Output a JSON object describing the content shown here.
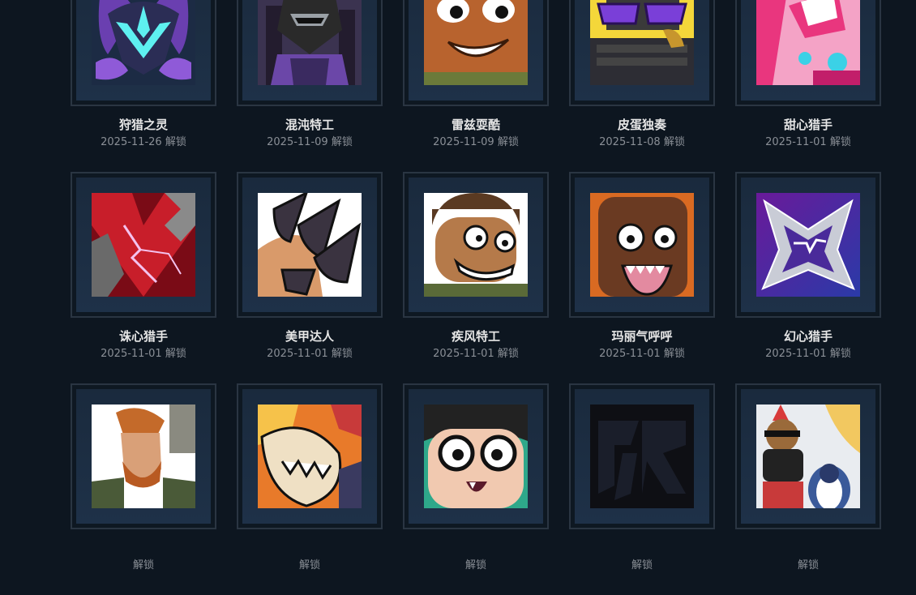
{
  "unlock_suffix": "解锁",
  "cards": [
    {
      "name": "狩猎之灵",
      "date": "2025-11-26",
      "icon": "hunting-spirit-mask-icon"
    },
    {
      "name": "混沌特工",
      "date": "2025-11-09",
      "icon": "chaos-agent-robot-icon"
    },
    {
      "name": "雷兹耍酷",
      "date": "2025-11-09",
      "icon": "raze-grin-icon"
    },
    {
      "name": "皮蛋独奏",
      "date": "2025-11-08",
      "icon": "sunglasses-keyboard-icon"
    },
    {
      "name": "甜心猎手",
      "date": "2025-11-01",
      "icon": "candy-hunter-icon"
    },
    {
      "name": "诛心猎手",
      "date": "2025-11-01",
      "icon": "red-chevron-lightning-icon"
    },
    {
      "name": "美甲达人",
      "date": "2025-11-01",
      "icon": "painted-claws-icon"
    },
    {
      "name": "疾风特工",
      "date": "2025-11-01",
      "icon": "angry-agent-face-icon"
    },
    {
      "name": "玛丽气呼呼",
      "date": "2025-11-01",
      "icon": "angry-fanged-face-icon"
    },
    {
      "name": "幻心猎手",
      "date": "2025-11-01",
      "icon": "neon-star-icon"
    },
    {
      "name": "",
      "date": "",
      "icon": "bearded-agent-icon"
    },
    {
      "name": "",
      "date": "",
      "icon": "fanged-creature-icon"
    },
    {
      "name": "",
      "date": "",
      "icon": "glasses-girl-face-icon"
    },
    {
      "name": "",
      "date": "",
      "icon": "dark-team-logo-icon"
    },
    {
      "name": "",
      "date": "",
      "icon": "bear-and-penguin-icon"
    }
  ]
}
